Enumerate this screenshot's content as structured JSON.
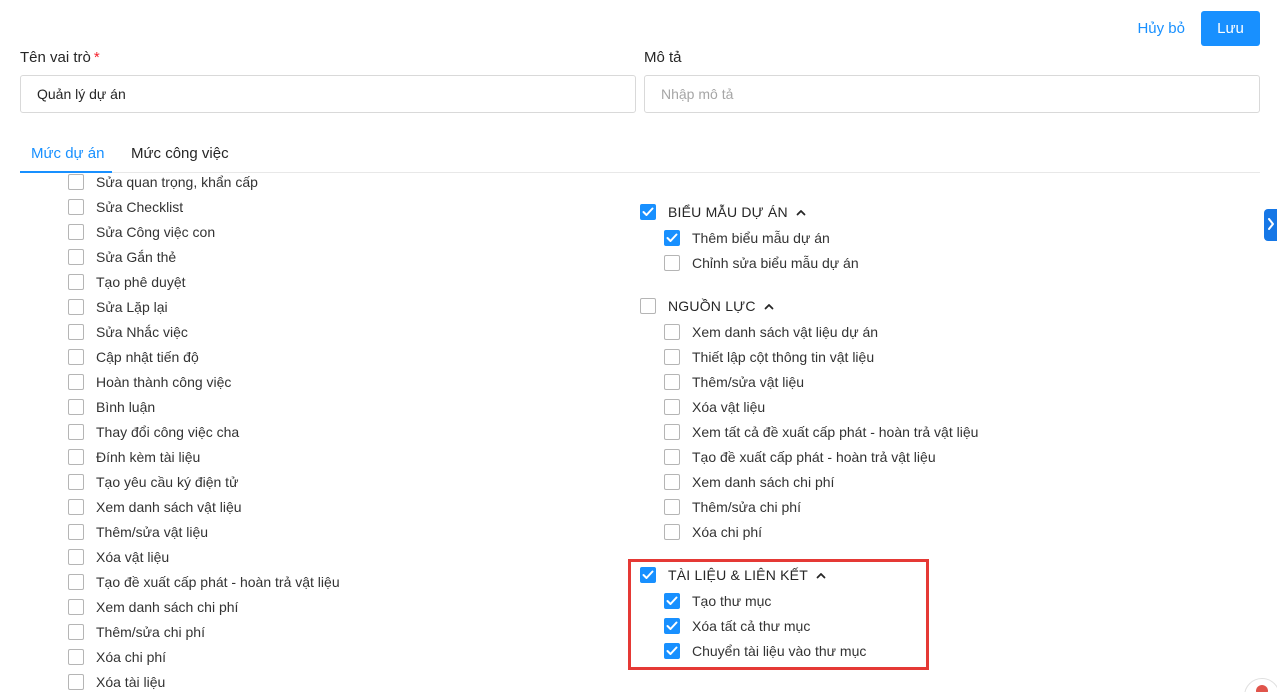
{
  "header": {
    "cancel_label": "Hủy bỏ",
    "save_label": "Lưu"
  },
  "form": {
    "role_name_label": "Tên vai trò",
    "required_mark": "*",
    "role_name_value": "Quản lý dự án",
    "description_label": "Mô tả",
    "description_placeholder": "Nhập mô tả"
  },
  "tabs": [
    {
      "label": "Mức dự án",
      "active": true
    },
    {
      "label": "Mức công việc",
      "active": false
    }
  ],
  "left_permissions": [
    {
      "label": "Sửa quan trọng, khẩn cấp",
      "checked": false
    },
    {
      "label": "Sửa Checklist",
      "checked": false
    },
    {
      "label": "Sửa Công việc con",
      "checked": false
    },
    {
      "label": "Sửa Gắn thẻ",
      "checked": false
    },
    {
      "label": "Tạo phê duyệt",
      "checked": false
    },
    {
      "label": "Sửa Lặp lại",
      "checked": false
    },
    {
      "label": "Sửa Nhắc việc",
      "checked": false
    },
    {
      "label": "Cập nhật tiến độ",
      "checked": false
    },
    {
      "label": "Hoàn thành công việc",
      "checked": false
    },
    {
      "label": "Bình luận",
      "checked": false
    },
    {
      "label": "Thay đổi công việc cha",
      "checked": false
    },
    {
      "label": "Đính kèm tài liệu",
      "checked": false
    },
    {
      "label": "Tạo yêu cầu ký điện tử",
      "checked": false
    },
    {
      "label": "Xem danh sách vật liệu",
      "checked": false
    },
    {
      "label": "Thêm/sửa vật liệu",
      "checked": false
    },
    {
      "label": "Xóa vật liệu",
      "checked": false
    },
    {
      "label": "Tạo đề xuất cấp phát - hoàn trả vật liệu",
      "checked": false
    },
    {
      "label": "Xem danh sách chi phí",
      "checked": false
    },
    {
      "label": "Thêm/sửa chi phí",
      "checked": false
    },
    {
      "label": "Xóa chi phí",
      "checked": false
    },
    {
      "label": "Xóa tài liệu",
      "checked": false
    }
  ],
  "groups": [
    {
      "title": "BIỂU MẪU DỰ ÁN",
      "checked": true,
      "items": [
        {
          "label": "Thêm biểu mẫu dự án",
          "checked": true
        },
        {
          "label": "Chỉnh sửa biểu mẫu dự án",
          "checked": false
        }
      ]
    },
    {
      "title": "NGUỒN LỰC",
      "checked": false,
      "items": [
        {
          "label": "Xem danh sách vật liệu dự án",
          "checked": false
        },
        {
          "label": "Thiết lập cột thông tin vật liệu",
          "checked": false
        },
        {
          "label": "Thêm/sửa vật liệu",
          "checked": false
        },
        {
          "label": "Xóa vật liệu",
          "checked": false
        },
        {
          "label": "Xem tất cả đề xuất cấp phát - hoàn trả vật liệu",
          "checked": false
        },
        {
          "label": "Tạo đề xuất cấp phát - hoàn trả vật liệu",
          "checked": false
        },
        {
          "label": "Xem danh sách chi phí",
          "checked": false
        },
        {
          "label": "Thêm/sửa chi phí",
          "checked": false
        },
        {
          "label": "Xóa chi phí",
          "checked": false
        }
      ]
    },
    {
      "title": "TÀI LIỆU & LIÊN KẾT",
      "checked": true,
      "items": [
        {
          "label": "Tạo thư mục",
          "checked": true
        },
        {
          "label": "Xóa tất cả thư mục",
          "checked": true
        },
        {
          "label": "Chuyển tài liệu vào thư mục",
          "checked": true
        }
      ]
    }
  ],
  "icons": {
    "checkmark": "check-icon",
    "group_toggle": "chevron-up-icon",
    "side_panel": "chevron-right-icon"
  },
  "colors": {
    "accent": "#1890ff",
    "highlight": "#e53935",
    "checkbox_border": "#b5b5b5",
    "divider": "#e8e8e8"
  }
}
